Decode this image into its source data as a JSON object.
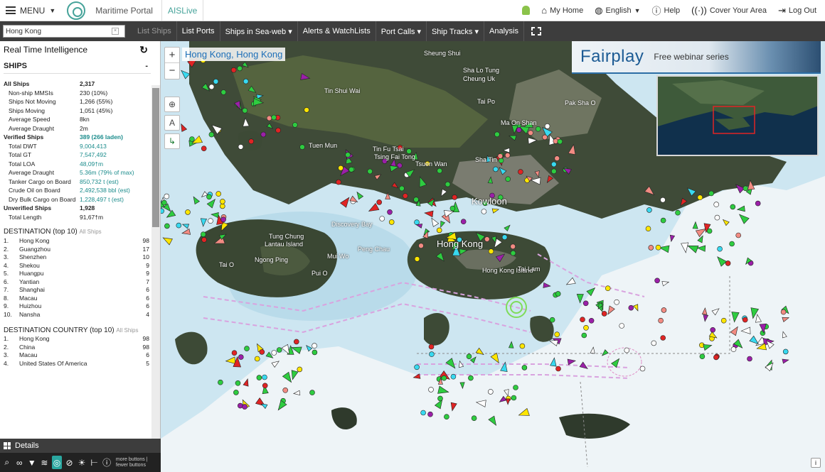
{
  "topbar": {
    "menu_label": "MENU",
    "portal_name": "Maritime Portal",
    "active_app": "AISLive",
    "links": [
      {
        "label": "My Home",
        "icon": "home-icon"
      },
      {
        "label": "English",
        "icon": "globe-icon"
      },
      {
        "label": "Help",
        "icon": "help-icon"
      },
      {
        "label": "Cover Your Area",
        "icon": "antenna-icon"
      },
      {
        "label": "Log Out",
        "icon": "logout-icon"
      }
    ]
  },
  "navbar": {
    "search_value": "Hong Kong",
    "items": [
      {
        "label": "List Ships",
        "disabled": true
      },
      {
        "label": "List Ports"
      },
      {
        "label": "Ships in Sea-web ▾"
      },
      {
        "label": "Alerts & WatchLists"
      },
      {
        "label": "Port Calls ▾"
      },
      {
        "label": "Ship Tracks ▾"
      },
      {
        "label": "Analysis"
      }
    ]
  },
  "sidebar": {
    "title": "Real Time Intelligence",
    "section": "SHIPS",
    "section_toggle": "-",
    "stats": [
      {
        "label": "All Ships",
        "value": "2,317",
        "bold": true
      },
      {
        "label": "Non-ship MMSIs",
        "value": "230 (10%)",
        "indent": true
      },
      {
        "label": "Ships Not Moving",
        "value": "1,266 (55%)",
        "indent": true
      },
      {
        "label": "Ships Moving",
        "value": "1,051 (45%)",
        "indent": true
      },
      {
        "label": "Average Speed",
        "value": "8kn",
        "indent": true
      },
      {
        "label": "Average Draught",
        "value": "2m",
        "indent": true
      },
      {
        "label": "Verified Ships",
        "value": "389 (266 laden)",
        "bold": true,
        "teal": true
      },
      {
        "label": "Total DWT",
        "value": "9,004,413",
        "indent": true,
        "teal": true
      },
      {
        "label": "Total GT",
        "value": "7,547,492",
        "indent": true,
        "teal": true
      },
      {
        "label": "Total LOA",
        "value": "48,09†m",
        "indent": true,
        "teal": true
      },
      {
        "label": "Average Draught",
        "value": "5.36m (79% of max)",
        "indent": true,
        "teal": true
      },
      {
        "label": "Tanker Cargo on Board",
        "value": "850,732 t (est)",
        "indent": true,
        "teal": true
      },
      {
        "label": "Crude Oil on Board",
        "value": "2,492,538 bbl (est)",
        "indent": true,
        "teal": true
      },
      {
        "label": "Dry Bulk Cargo on Board",
        "value": "1,228,497 t (est)",
        "indent": true,
        "teal": true
      },
      {
        "label": "Unverified Ships",
        "value": "1,928",
        "bold": true
      },
      {
        "label": "Total Length",
        "value": "91,67†m",
        "indent": true
      }
    ],
    "destination_title": "DESTINATION (top 10)",
    "destination_sub": "All Ships",
    "destinations": [
      {
        "n": "1.",
        "name": "Hong Kong",
        "count": "98"
      },
      {
        "n": "2.",
        "name": "Guangzhou",
        "count": "17"
      },
      {
        "n": "3.",
        "name": "Shenzhen",
        "count": "10"
      },
      {
        "n": "4.",
        "name": "Shekou",
        "count": "9"
      },
      {
        "n": "5.",
        "name": "Huangpu",
        "count": "9"
      },
      {
        "n": "6.",
        "name": "Yantian",
        "count": "7"
      },
      {
        "n": "7.",
        "name": "Shanghai",
        "count": "6"
      },
      {
        "n": "8.",
        "name": "Macau",
        "count": "6"
      },
      {
        "n": "9.",
        "name": "Huizhou",
        "count": "6"
      },
      {
        "n": "10.",
        "name": "Nansha",
        "count": "4"
      }
    ],
    "country_title": "DESTINATION COUNTRY (top 10)",
    "country_sub": "All Ships",
    "countries": [
      {
        "n": "1.",
        "name": "Hong Kong",
        "count": "98"
      },
      {
        "n": "2.",
        "name": "China",
        "count": "98"
      },
      {
        "n": "3.",
        "name": "Macau",
        "count": "6"
      },
      {
        "n": "4.",
        "name": "United States Of America",
        "count": "5"
      }
    ]
  },
  "details_bar": {
    "label": "Details"
  },
  "toolbar": {
    "tools": [
      "search-icon",
      "binoculars-icon",
      "filter-icon",
      "layers-icon",
      "layers-active-icon",
      "compass-icon",
      "sun-icon",
      "measure-icon",
      "info-icon"
    ],
    "note_line1": "more buttons | fewer buttons"
  },
  "map": {
    "location_label": "Hong Kong, Hong Kong",
    "ad_brand": "Fairplay",
    "ad_tagline": "Free webinar series",
    "places": [
      "Sheung Shui",
      "Sha Lo Tung",
      "Cheung Uk",
      "Tin Shui Wai",
      "Tai Po",
      "Pak Sha O",
      "Ma On Shan",
      "Tuen Mun",
      "Tin Fu Tsai",
      "Tsing Fai Tong",
      "Tsuen Wan",
      "Sha Tin",
      "Kowloon",
      "Discovery Bay",
      "Tung Chung",
      "Lantau Island",
      "Ngong Ping",
      "Mui Wo",
      "Tai O",
      "Peng Chau",
      "Pui O",
      "Hong Kong",
      "Hong Kong Island",
      "Tai Lam"
    ],
    "info": "i"
  },
  "colors": {
    "teal": "#1b8c8c",
    "nav_bg": "#3d3d3d",
    "water": "#cfe8f2",
    "land": "#3c4a36"
  }
}
